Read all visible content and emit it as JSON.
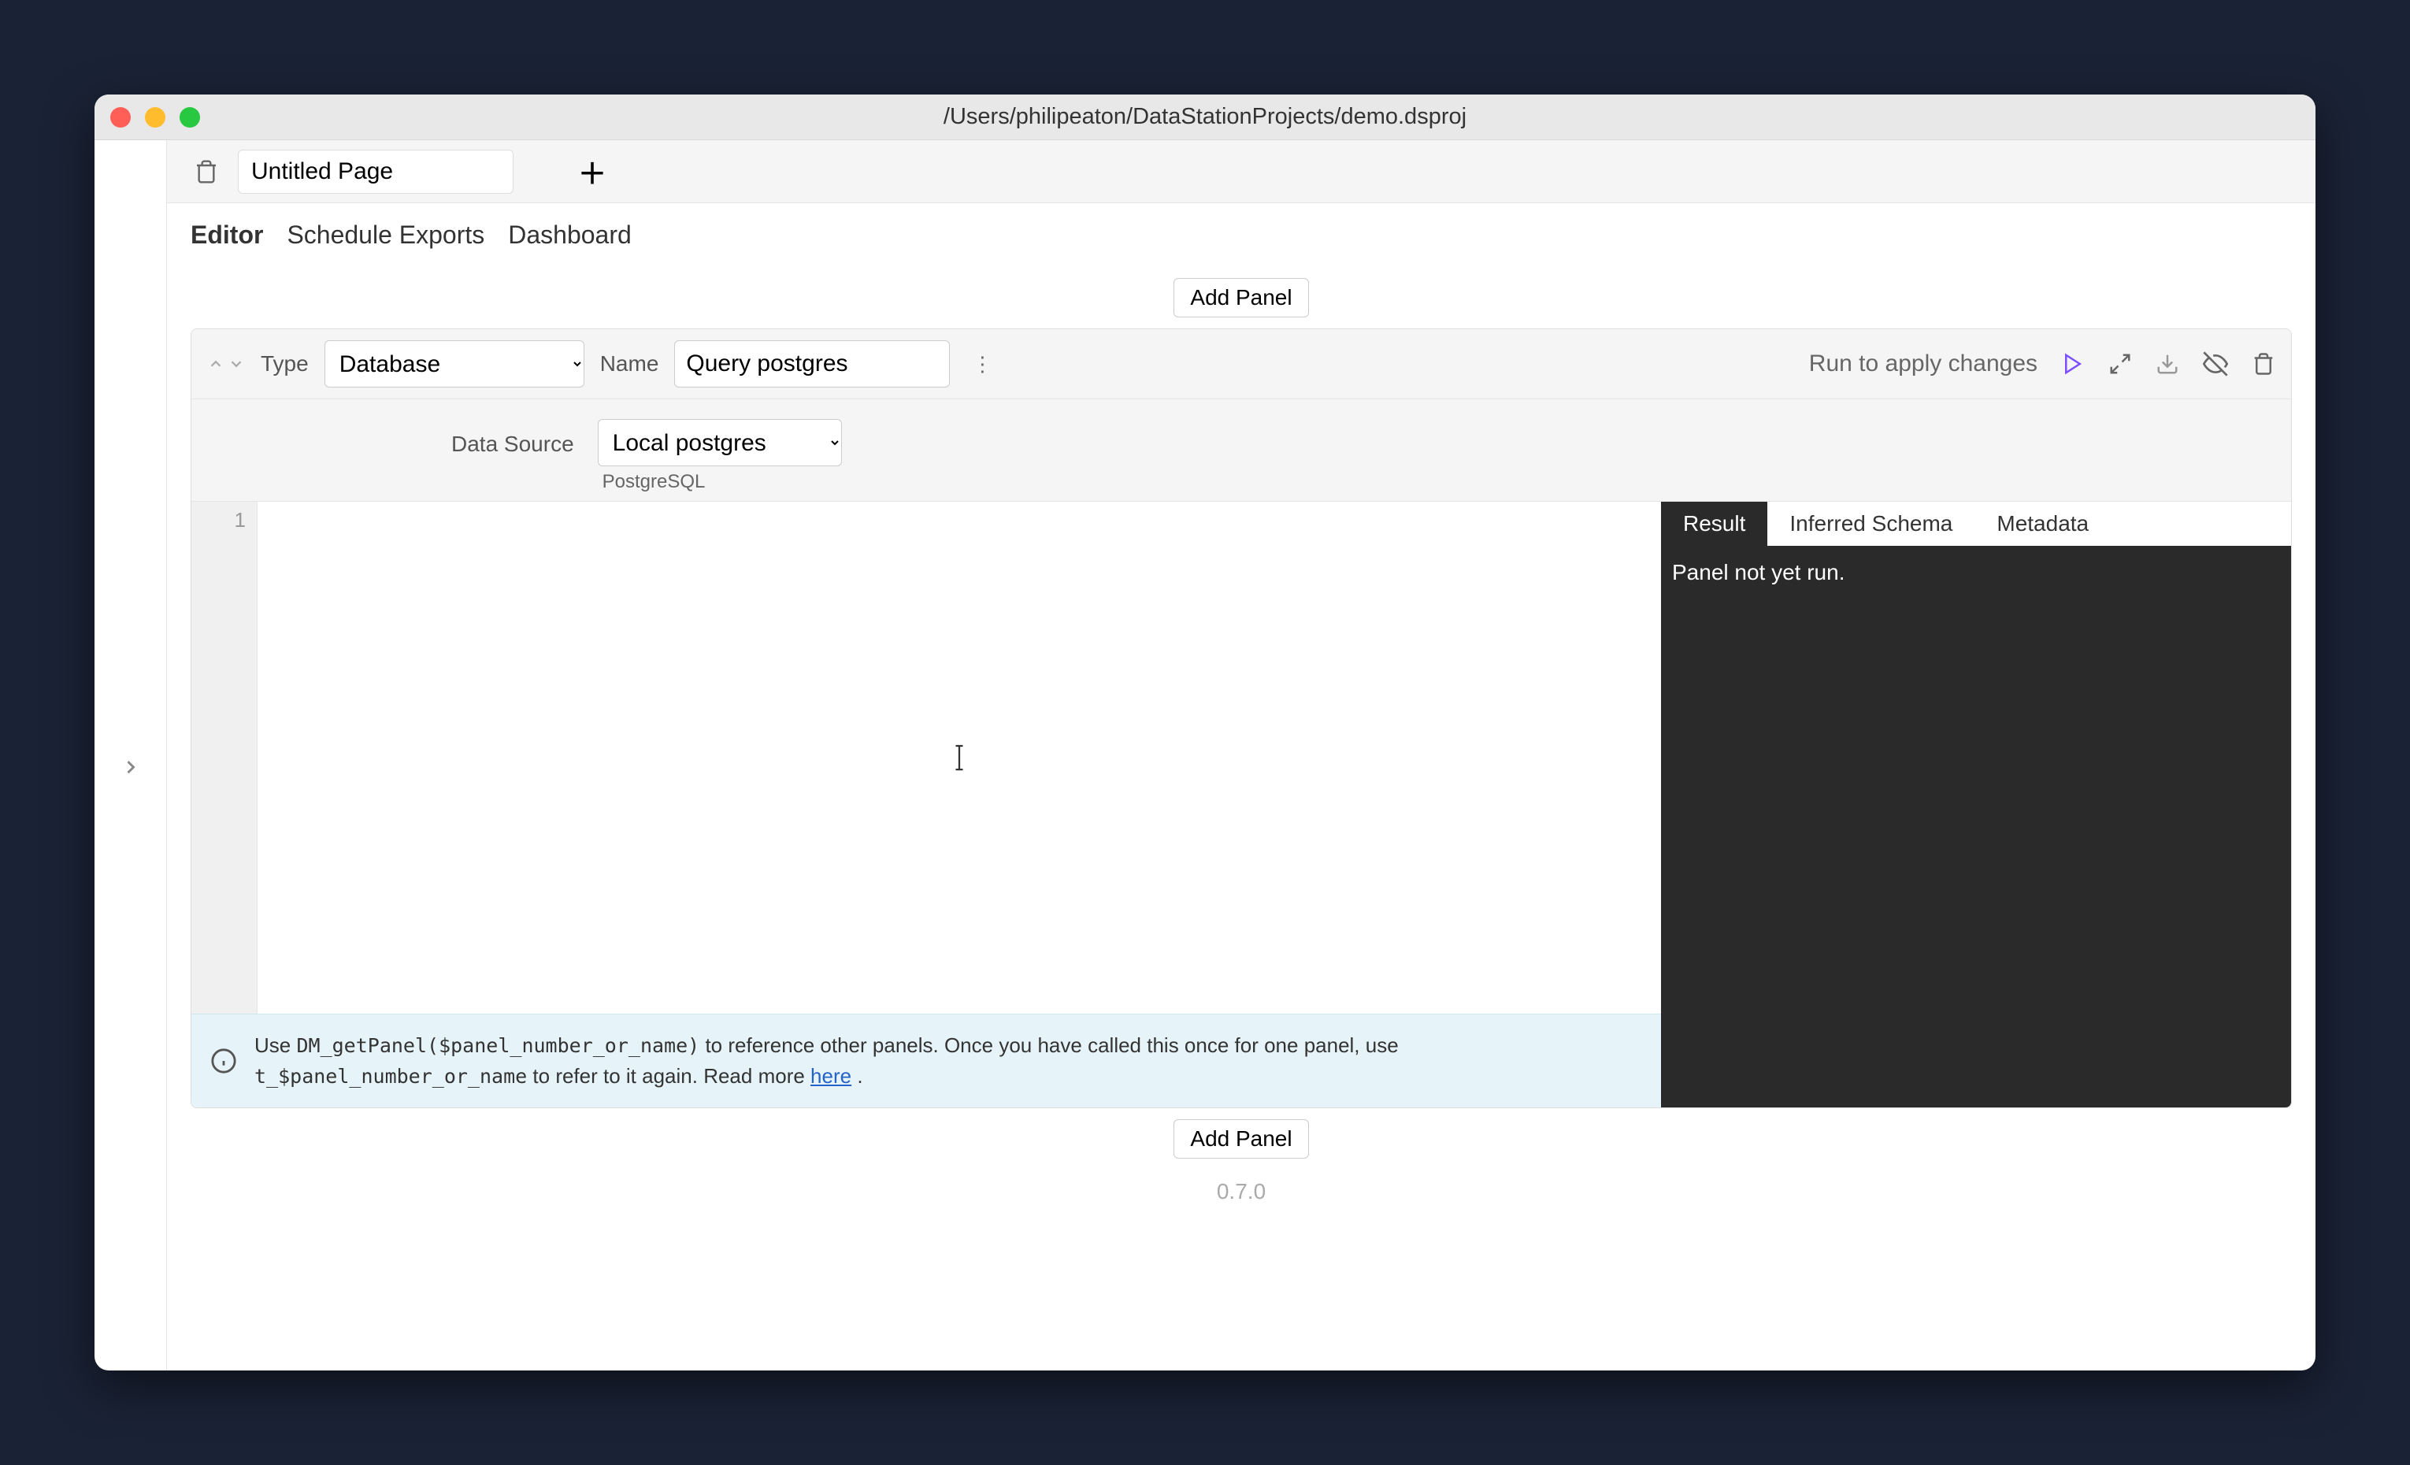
{
  "window": {
    "title": "/Users/philipeaton/DataStationProjects/demo.dsproj"
  },
  "page": {
    "name": "Untitled Page"
  },
  "view_tabs": {
    "editor": "Editor",
    "schedule_exports": "Schedule Exports",
    "dashboard": "Dashboard"
  },
  "buttons": {
    "add_panel": "Add Panel"
  },
  "panel": {
    "type_label": "Type",
    "type_value": "Database",
    "name_label": "Name",
    "name_value": "Query postgres",
    "run_text": "Run to apply changes",
    "data_source_label": "Data Source",
    "data_source_value": "Local postgres",
    "data_source_subtext": "PostgreSQL"
  },
  "editor": {
    "gutter_line": "1"
  },
  "info": {
    "text_prefix": "Use ",
    "code1": "DM_getPanel($panel_number_or_name)",
    "text_mid": " to reference other panels. Once you have called this once for one panel, use ",
    "code2": "t_$panel_number_or_name",
    "text_suffix": " to refer to it again. Read more ",
    "link_text": "here",
    "text_end": " ."
  },
  "results": {
    "tab_result": "Result",
    "tab_schema": "Inferred Schema",
    "tab_metadata": "Metadata",
    "body_text": "Panel not yet run."
  },
  "footer": {
    "version": "0.7.0"
  }
}
